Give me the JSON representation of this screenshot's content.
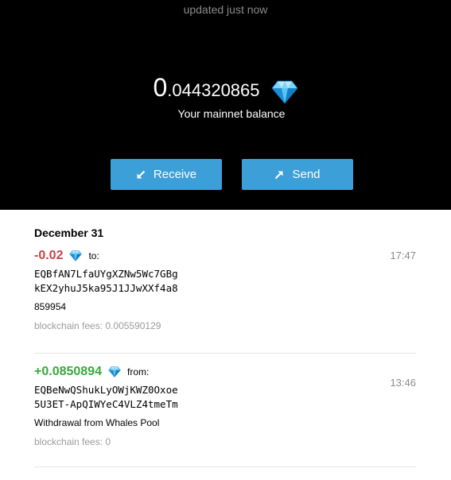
{
  "header": {
    "updated": "updated just now",
    "balance_int": "0",
    "balance_frac": ".044320865",
    "balance_label": "Your mainnet balance"
  },
  "actions": {
    "receive_label": "Receive",
    "send_label": "Send"
  },
  "transactions": {
    "date": "December 31",
    "items": [
      {
        "amount": "-0.02",
        "direction": "to:",
        "address_line1": "EQBfAN7LfaUYgXZNw5Wc7GBg",
        "address_line2": "kEX2yhuJ5ka95J1JJwXXf4a8",
        "comment": "859954",
        "fees": "blockchain fees: 0.005590129",
        "time": "17:47"
      },
      {
        "amount": "+0.0850894",
        "direction": "from:",
        "address_line1": "EQBeNwQShukLyOWjKWZ0Oxoe",
        "address_line2": "5U3ET-ApQIWYeC4VLZ4tmeTm",
        "comment": "Withdrawal from Whales Pool",
        "fees": "blockchain fees: 0",
        "time": "13:46"
      }
    ]
  },
  "colors": {
    "header_bg": "#000000",
    "button_bg": "#3d9fd8",
    "negative": "#c8424a",
    "positive": "#3aa83e",
    "muted": "#8a8a8a",
    "gem": "#2fa7e8"
  },
  "icons": {
    "currency": "diamond-icon",
    "receive": "arrow-down-left-icon",
    "send": "arrow-up-right-icon"
  }
}
